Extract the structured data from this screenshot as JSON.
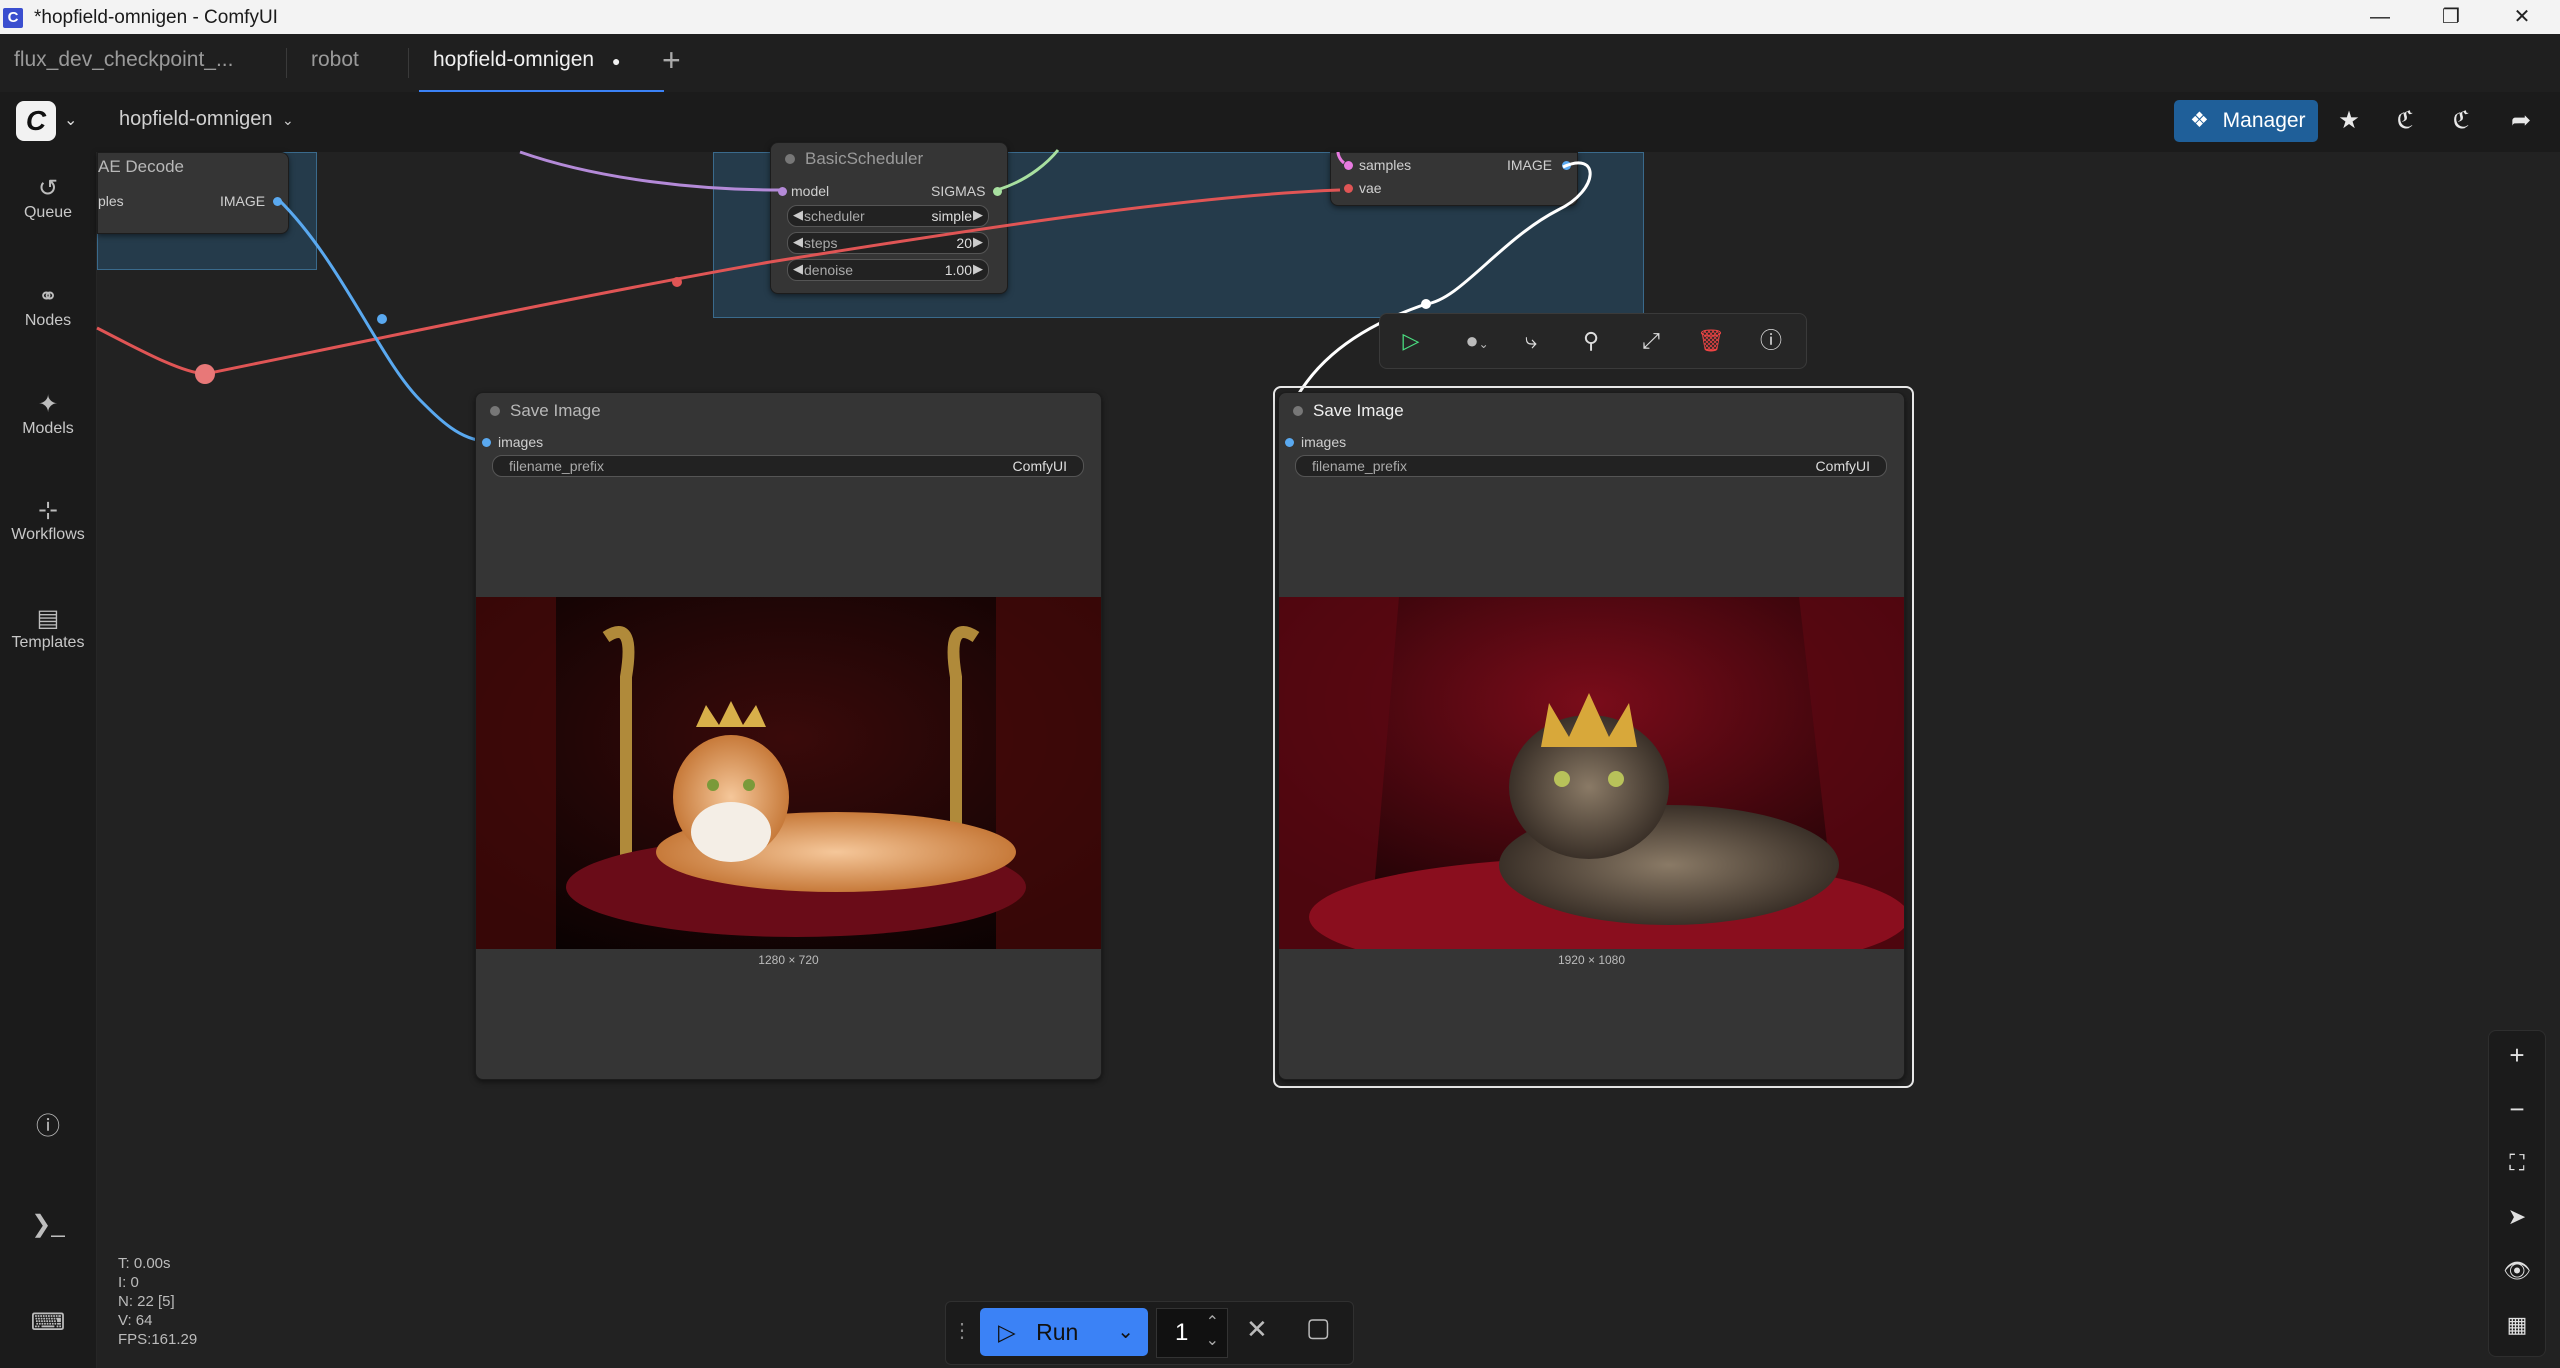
{
  "window": {
    "title": "*hopfield-omnigen - ComfyUI",
    "app_icon": "C"
  },
  "tabs": [
    {
      "label": "flux_dev_checkpoint_..."
    },
    {
      "label": "robot"
    },
    {
      "label": "hopfield-omnigen",
      "active": true,
      "modified_dot": "●"
    }
  ],
  "menubar": {
    "logo": "C",
    "workflow_name": "hopfield-omnigen",
    "manager_label": "Manager"
  },
  "sidebar": {
    "items": [
      {
        "label": "Queue",
        "icon": "history-icon"
      },
      {
        "label": "Nodes",
        "icon": "node-icon"
      },
      {
        "label": "Models",
        "icon": "models-icon"
      },
      {
        "label": "Workflows",
        "icon": "workflows-icon"
      },
      {
        "label": "Templates",
        "icon": "templates-icon"
      }
    ]
  },
  "nodes": {
    "vae_decode": {
      "title": "AE Decode",
      "input": "ples",
      "output": "IMAGE"
    },
    "basic_scheduler": {
      "title": "BasicScheduler",
      "input": "model",
      "output": "SIGMAS",
      "widgets": [
        {
          "label": "scheduler",
          "value": "simple"
        },
        {
          "label": "steps",
          "value": "20"
        },
        {
          "label": "denoise",
          "value": "1.00"
        }
      ]
    },
    "vae_decode_2": {
      "input_samples": "samples",
      "input_vae": "vae",
      "output": "IMAGE"
    },
    "save_image_1": {
      "title": "Save Image",
      "input": "images",
      "widget_label": "filename_prefix",
      "widget_value": "ComfyUI",
      "caption": "1280 × 720"
    },
    "save_image_2": {
      "title": "Save Image",
      "input": "images",
      "widget_label": "filename_prefix",
      "widget_value": "ComfyUI",
      "caption": "1920 × 1080"
    }
  },
  "runbar": {
    "run_label": "Run",
    "queue_count": "1"
  },
  "stats": {
    "t": "T: 0.00s",
    "i": "I: 0",
    "n": "N: 22 [5]",
    "v": "V: 64",
    "fps": "FPS:161.29"
  },
  "colors": {
    "accent": "#3b82f6",
    "manager": "#1f5f99",
    "wire_red": "#e05555",
    "wire_blue": "#5aa9f0",
    "wire_purple": "#b48ad8",
    "wire_green": "#a8e0a0"
  }
}
